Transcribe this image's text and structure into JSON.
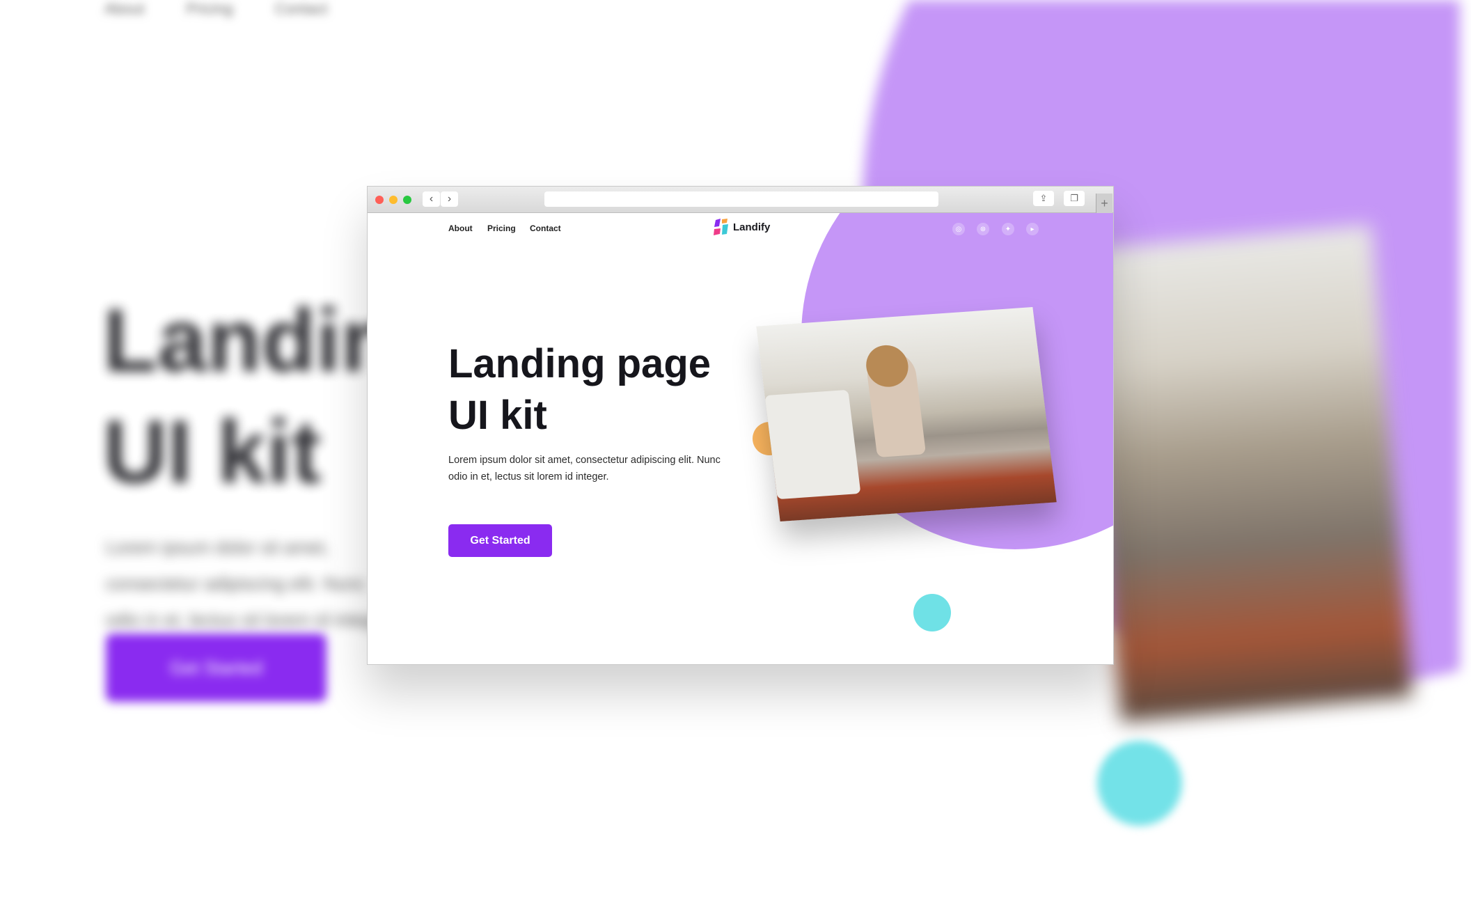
{
  "background": {
    "nav": [
      "About",
      "Pricing",
      "Contact"
    ],
    "title_lines": [
      "Landing page",
      "UI kit"
    ],
    "paragraph": "Lorem ipsum dolor sit amet, consectetur adipiscing elit. Nunc odio in et, lectus sit lorem id integer.",
    "cta": "Get Started"
  },
  "browser": {
    "url": "",
    "nav_back_icon": "chevron-left",
    "nav_forward_icon": "chevron-right",
    "share_icon": "share",
    "tabs_icon": "tabs",
    "new_tab_label": "+"
  },
  "page": {
    "nav": {
      "items": [
        "About",
        "Pricing",
        "Contact"
      ]
    },
    "logo": {
      "name": "Landify"
    },
    "social": [
      "instagram",
      "dribbble",
      "twitter",
      "youtube"
    ],
    "hero": {
      "title_line1": "Landing page",
      "title_line2": "UI kit",
      "paragraph": "Lorem ipsum dolor sit amet, consectetur adipiscing elit. Nunc odio in et, lectus sit lorem id integer.",
      "cta": "Get Started"
    }
  },
  "colors": {
    "accent": "#8a2bf0",
    "blob": "#c596f7",
    "cyan": "#6fe1e6",
    "orange": "#f9b45e"
  }
}
